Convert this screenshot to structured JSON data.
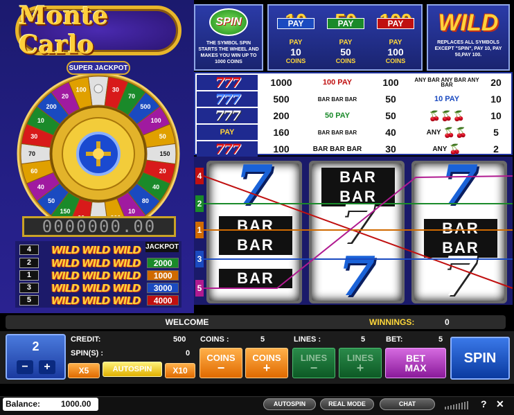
{
  "logo": {
    "text": "Monte Carlo"
  },
  "wheel": {
    "label": "SUPER JACKPOT",
    "segments": [
      "10",
      "30",
      "70",
      "500",
      "100",
      "50",
      "150",
      "20",
      "40",
      "80",
      "10",
      "200",
      "500",
      "20",
      "150",
      "50",
      "40",
      "60",
      "70",
      "30",
      "10",
      "200",
      "20",
      "100"
    ]
  },
  "counter": {
    "value": "0000000.00"
  },
  "jackpot": {
    "header": "JACKPOT",
    "rows": [
      {
        "lines": "4",
        "wild": "WILD WILD WILD",
        "value": "",
        "color": "#111111"
      },
      {
        "lines": "2",
        "wild": "WILD WILD WILD",
        "value": "2000",
        "color": "#1a8a2a"
      },
      {
        "lines": "1",
        "wild": "WILD WILD WILD",
        "value": "1000",
        "color": "#d06a00"
      },
      {
        "lines": "3",
        "wild": "WILD WILD WILD",
        "value": "3000",
        "color": "#1a4ac0"
      },
      {
        "lines": "5",
        "wild": "WILD WILD WILD",
        "value": "4000",
        "color": "#c01010"
      }
    ]
  },
  "info": {
    "spin_symbol": "SPIN",
    "spin_text": "THE SYMBOL SPIN STARTS THE WHEEL AND MAKES YOU WIN UP TO 1000 COINS",
    "pays": [
      {
        "symbol": "10",
        "word": "PAY",
        "label": "PAY",
        "value": "10",
        "unit": "COINS"
      },
      {
        "symbol": "50",
        "word": "PAY",
        "label": "PAY",
        "value": "50",
        "unit": "COINS"
      },
      {
        "symbol": "100",
        "word": "PAY",
        "label": "PAY",
        "value": "100",
        "unit": "COINS"
      }
    ],
    "wild_symbol": "WILD",
    "wild_text": "REPLACES ALL SYMBOLS EXCEPT \"SPIN\", PAY 10, PAY 50,PAY 100."
  },
  "paytable": {
    "col1": [
      {
        "sym": "777",
        "val": "1000"
      },
      {
        "sym": "777",
        "val": "500"
      },
      {
        "sym": "777",
        "val": "200"
      },
      {
        "sym": "PAY",
        "val": "160"
      },
      {
        "sym": "777",
        "val": "100"
      }
    ],
    "col2": [
      {
        "sym": "100 PAY",
        "val": "100"
      },
      {
        "sym": "BAR BAR BAR",
        "val": "50"
      },
      {
        "sym": "50 PAY",
        "val": "50"
      },
      {
        "sym": "BAR BAR BAR",
        "val": "40"
      },
      {
        "sym": "BAR BAR BAR",
        "val": "30"
      }
    ],
    "col3": [
      {
        "sym": "ANY BAR ANY BAR ANY BAR",
        "val": "20"
      },
      {
        "sym": "10 PAY",
        "val": "10"
      },
      {
        "sym": "cherries",
        "val": "10"
      },
      {
        "sym": "ANY",
        "val": "5"
      },
      {
        "sym": "ANY",
        "val": "2"
      }
    ],
    "any_label": "ANY",
    "any_bar": "ANY BAR",
    "bar": "BAR"
  },
  "reels": {
    "line_numbers": [
      "4",
      "2",
      "1",
      "3",
      "5"
    ],
    "line_colors": [
      "#c01010",
      "#1a8a2a",
      "#d06a00",
      "#1a4ac0",
      "#b01a90"
    ],
    "reel1": [
      "7",
      "BAR BAR",
      "BAR",
      "7"
    ],
    "reel2": [
      "BAR BAR",
      "7",
      "7"
    ],
    "reel3": [
      "7",
      "BAR BAR",
      "7"
    ]
  },
  "status": {
    "welcome": "WELCOME",
    "winnings_label": "WINNINGS:",
    "winnings_value": "0"
  },
  "controls": {
    "bet_level": "2",
    "credit_label": "CREDIT:",
    "credit_value": "500",
    "spins_label": "SPIN(S) :",
    "spins_value": "0",
    "coins_label": "COINS :",
    "coins_value": "5",
    "lines_label": "LINES :",
    "lines_value": "5",
    "bet_label": "BET:",
    "bet_value": "5",
    "x5": "X5",
    "autospin": "AUTOSPIN",
    "x10": "X10",
    "coins_minus": "COINS",
    "coins_plus": "COINS",
    "lines_minus": "LINES",
    "lines_plus": "LINES",
    "bet_max_1": "BET",
    "bet_max_2": "MAX",
    "spin": "SPIN",
    "minus": "−",
    "plus": "+"
  },
  "footer": {
    "balance_label": "Balance:",
    "balance_value": "1000.00",
    "autospin": "AUTOSPIN",
    "real_mode": "REAL MODE",
    "chat": "CHAT",
    "help": "?",
    "close": "✕"
  }
}
